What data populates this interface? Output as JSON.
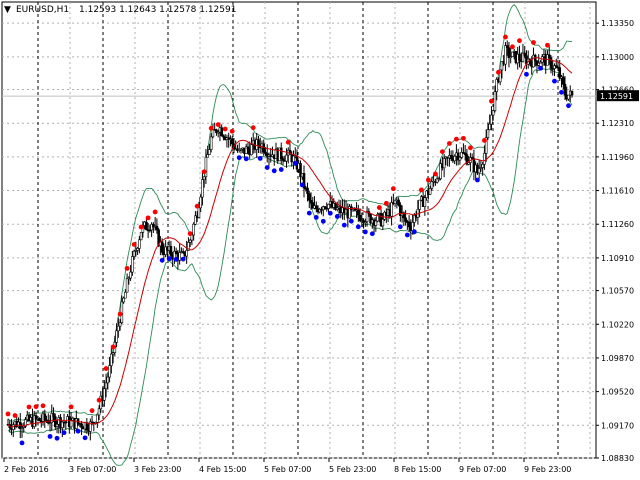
{
  "header": {
    "symbol_timeframe": "EURUSD,H1",
    "ohlc": "1.12593 1.12643 1.12578 1.12591",
    "collapse_glyph": "▼"
  },
  "price_axis": {
    "labels": [
      "1.13350",
      "1.13000",
      "1.12660",
      "1.12310",
      "1.11960",
      "1.11610",
      "1.11260",
      "1.10910",
      "1.10570",
      "1.10220",
      "1.09870",
      "1.09520",
      "1.09170",
      "1.08830"
    ],
    "min": 1.0883,
    "max": 1.1357,
    "current_price": "1.12591"
  },
  "time_axis": {
    "labels": [
      "2 Feb 2016",
      "3 Feb 07:00",
      "3 Feb 23:00",
      "4 Feb 15:00",
      "5 Feb 07:00",
      "5 Feb 23:00",
      "8 Feb 15:00",
      "9 Feb 07:00",
      "9 Feb 23:00"
    ]
  },
  "colors": {
    "background": "#ffffff",
    "candle": "#000000",
    "bands": "#2e8b57",
    "midline": "#cc0000",
    "dot_up": "#ff0000",
    "dot_down": "#0000ff",
    "bid_line": "#c0c0c0",
    "price_tag_bg": "#000000",
    "price_tag_fg": "#ffffff"
  },
  "chart_data": {
    "type": "candlestick",
    "symbol": "EURUSD",
    "timeframe": "H1",
    "indicators": [
      "bollinger-bands",
      "moving-average",
      "signal-dots"
    ],
    "grid": true,
    "y_range": [
      1.0883,
      1.1357
    ],
    "price_path": [
      [
        0,
        1.0918
      ],
      [
        8,
        1.092
      ],
      [
        16,
        1.0922
      ],
      [
        24,
        1.0923
      ],
      [
        32,
        1.0921
      ],
      [
        40,
        1.0919
      ],
      [
        48,
        1.0917
      ],
      [
        52,
        1.0935
      ],
      [
        58,
        1.0975
      ],
      [
        64,
        1.103
      ],
      [
        70,
        1.108
      ],
      [
        76,
        1.112
      ],
      [
        82,
        1.1128
      ],
      [
        88,
        1.11
      ],
      [
        94,
        1.1095
      ],
      [
        100,
        1.1092
      ],
      [
        104,
        1.111
      ],
      [
        108,
        1.114
      ],
      [
        112,
        1.118
      ],
      [
        116,
        1.1215
      ],
      [
        120,
        1.1228
      ],
      [
        126,
        1.1215
      ],
      [
        132,
        1.12
      ],
      [
        138,
        1.1205
      ],
      [
        144,
        1.121
      ],
      [
        150,
        1.12
      ],
      [
        156,
        1.1198
      ],
      [
        162,
        1.1196
      ],
      [
        166,
        1.1185
      ],
      [
        170,
        1.116
      ],
      [
        174,
        1.114
      ],
      [
        178,
        1.1145
      ],
      [
        182,
        1.1148
      ],
      [
        186,
        1.1142
      ],
      [
        190,
        1.114
      ],
      [
        196,
        1.1137
      ],
      [
        202,
        1.1135
      ],
      [
        208,
        1.1132
      ],
      [
        214,
        1.113
      ],
      [
        218,
        1.114
      ],
      [
        222,
        1.115
      ],
      [
        226,
        1.113
      ],
      [
        230,
        1.1125
      ],
      [
        234,
        1.1142
      ],
      [
        240,
        1.116
      ],
      [
        246,
        1.118
      ],
      [
        252,
        1.1195
      ],
      [
        256,
        1.12
      ],
      [
        260,
        1.1198
      ],
      [
        264,
        1.1192
      ],
      [
        268,
        1.118
      ],
      [
        272,
        1.12
      ],
      [
        276,
        1.124
      ],
      [
        280,
        1.128
      ],
      [
        284,
        1.1305
      ],
      [
        288,
        1.13
      ],
      [
        294,
        1.1298
      ],
      [
        300,
        1.1296
      ],
      [
        306,
        1.1298
      ],
      [
        310,
        1.1293
      ],
      [
        314,
        1.1285
      ],
      [
        318,
        1.1262
      ],
      [
        322,
        1.1259
      ]
    ]
  }
}
